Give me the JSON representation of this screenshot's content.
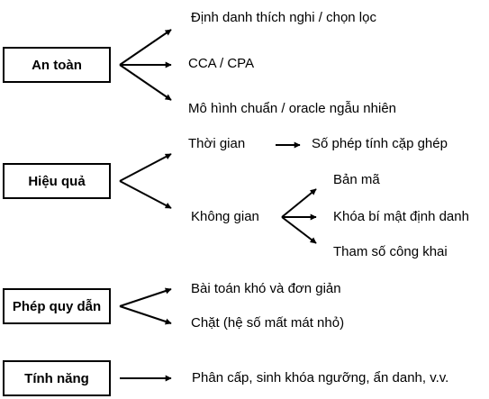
{
  "categories": {
    "security": {
      "title": "An toàn",
      "items": [
        "Định danh thích nghi / chọn lọc",
        "CCA / CPA",
        "Mô hình chuẩn / oracle ngẫu nhiên"
      ]
    },
    "efficiency": {
      "title": "Hiệu quả",
      "time": {
        "label": "Thời gian",
        "result": "Số phép tính cặp ghép"
      },
      "space": {
        "label": "Không gian",
        "items": [
          "Bản mã",
          "Khóa bí mật định danh",
          "Tham số công khai"
        ]
      }
    },
    "reduction": {
      "title": "Phép quy dẫn",
      "items": [
        "Bài toán khó và đơn giản",
        "Chặt (hệ số mất mát nhỏ)"
      ]
    },
    "features": {
      "title": "Tính năng",
      "items": [
        "Phân cấp, sinh khóa ngưỡng, ẩn danh, v.v."
      ]
    }
  }
}
